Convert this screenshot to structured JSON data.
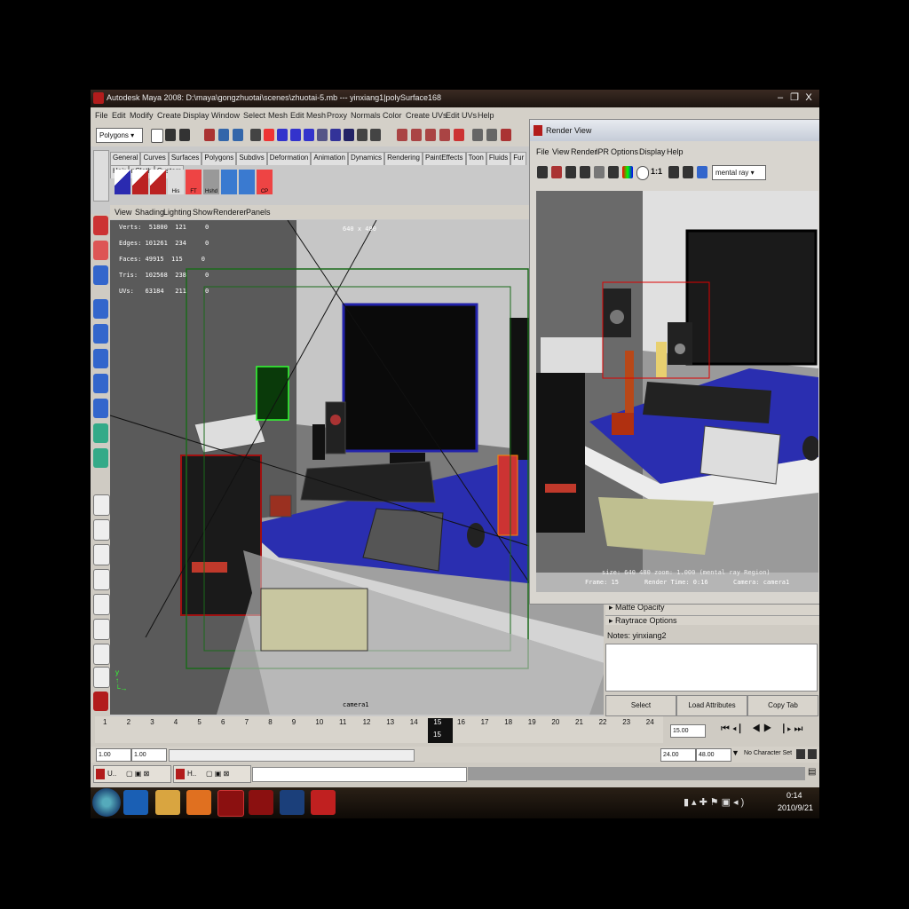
{
  "window": {
    "title": "Autodesk Maya 2008: D:\\maya\\gongzhuotai\\scenes\\zhuotai-5.mb  ---  yinxiang1|polySurface168",
    "minimize": "–",
    "maximize": "❐",
    "close": "X"
  },
  "menu": [
    "File",
    "Edit",
    "Modify",
    "Create",
    "Display",
    "Window",
    "Select",
    "Mesh",
    "Edit Mesh",
    "Proxy",
    "Normals",
    "Color",
    "Create UVs",
    "Edit UVs",
    "Help"
  ],
  "toolbar": {
    "mode": "Polygons"
  },
  "shelf": {
    "tabs": [
      "General",
      "Curves",
      "Surfaces",
      "Polygons",
      "Subdivs",
      "Deformation",
      "Animation",
      "Dynamics",
      "Rendering",
      "PaintEffects",
      "Toon",
      "Fluids",
      "Fur",
      "Hair",
      "nCloth",
      "Custom"
    ],
    "icons": [
      {
        "label": ""
      },
      {
        "label": ""
      },
      {
        "label": ""
      },
      {
        "label": "His"
      },
      {
        "label": "FT"
      },
      {
        "label": "Hshd"
      },
      {
        "label": ""
      },
      {
        "label": ""
      },
      {
        "label": "CP"
      }
    ]
  },
  "panel_menu": [
    "View",
    "Shading",
    "Lighting",
    "Show",
    "Renderer",
    "Panels"
  ],
  "hud": {
    "rows": [
      {
        "label": "Verts:",
        "a": "51800",
        "b": "121",
        "c": "0"
      },
      {
        "label": "Edges:",
        "a": "101261",
        "b": "234",
        "c": "0"
      },
      {
        "label": "Faces:",
        "a": "49915",
        "b": "115",
        "c": "0"
      },
      {
        "label": "Tris:",
        "a": "102568",
        "b": "238",
        "c": "0"
      },
      {
        "label": "UVs:",
        "a": "63184",
        "b": "211",
        "c": "0"
      }
    ],
    "resolution": "640 x 480",
    "camera": "camera1"
  },
  "render_view": {
    "title": "Render View",
    "menu": [
      "File",
      "View",
      "Render",
      "IPR",
      "Options",
      "Display",
      "Help"
    ],
    "ratio": "1:1",
    "renderer": "mental ray",
    "info_line1": "size:  640  480  zoom: 1.000     (mental ray  Region)",
    "frame": "Frame: 15",
    "render_time": "Render Time: 0:16",
    "camera": "Camera: camera1"
  },
  "attributes": {
    "section1": "Matte Opacity",
    "section2": "Raytrace Options",
    "notes_label": "Notes:  yinxiang2",
    "buttons": [
      "Select",
      "Load Attributes",
      "Copy Tab"
    ]
  },
  "timeline": {
    "ticks": [
      "1",
      "2",
      "3",
      "4",
      "5",
      "6",
      "7",
      "8",
      "9",
      "10",
      "11",
      "12",
      "13",
      "14",
      "15",
      "16",
      "17",
      "18",
      "19",
      "20",
      "21",
      "22",
      "23",
      "24"
    ],
    "current_frame": "15",
    "current_time": "15.00"
  },
  "range": {
    "start": "1.00",
    "start_inner": "1.00",
    "end_inner": "24.00",
    "end": "48.00",
    "char_set": "No Character Set"
  },
  "taskbar_windows": [
    {
      "label": "U.."
    },
    {
      "label": "H.."
    }
  ],
  "tray": {
    "time": "0:14",
    "date": "2010/9/21"
  },
  "colors": {
    "accent_red": "#b21c1c",
    "viewport": "#808080",
    "desk_blue": "#2a2eb0"
  }
}
